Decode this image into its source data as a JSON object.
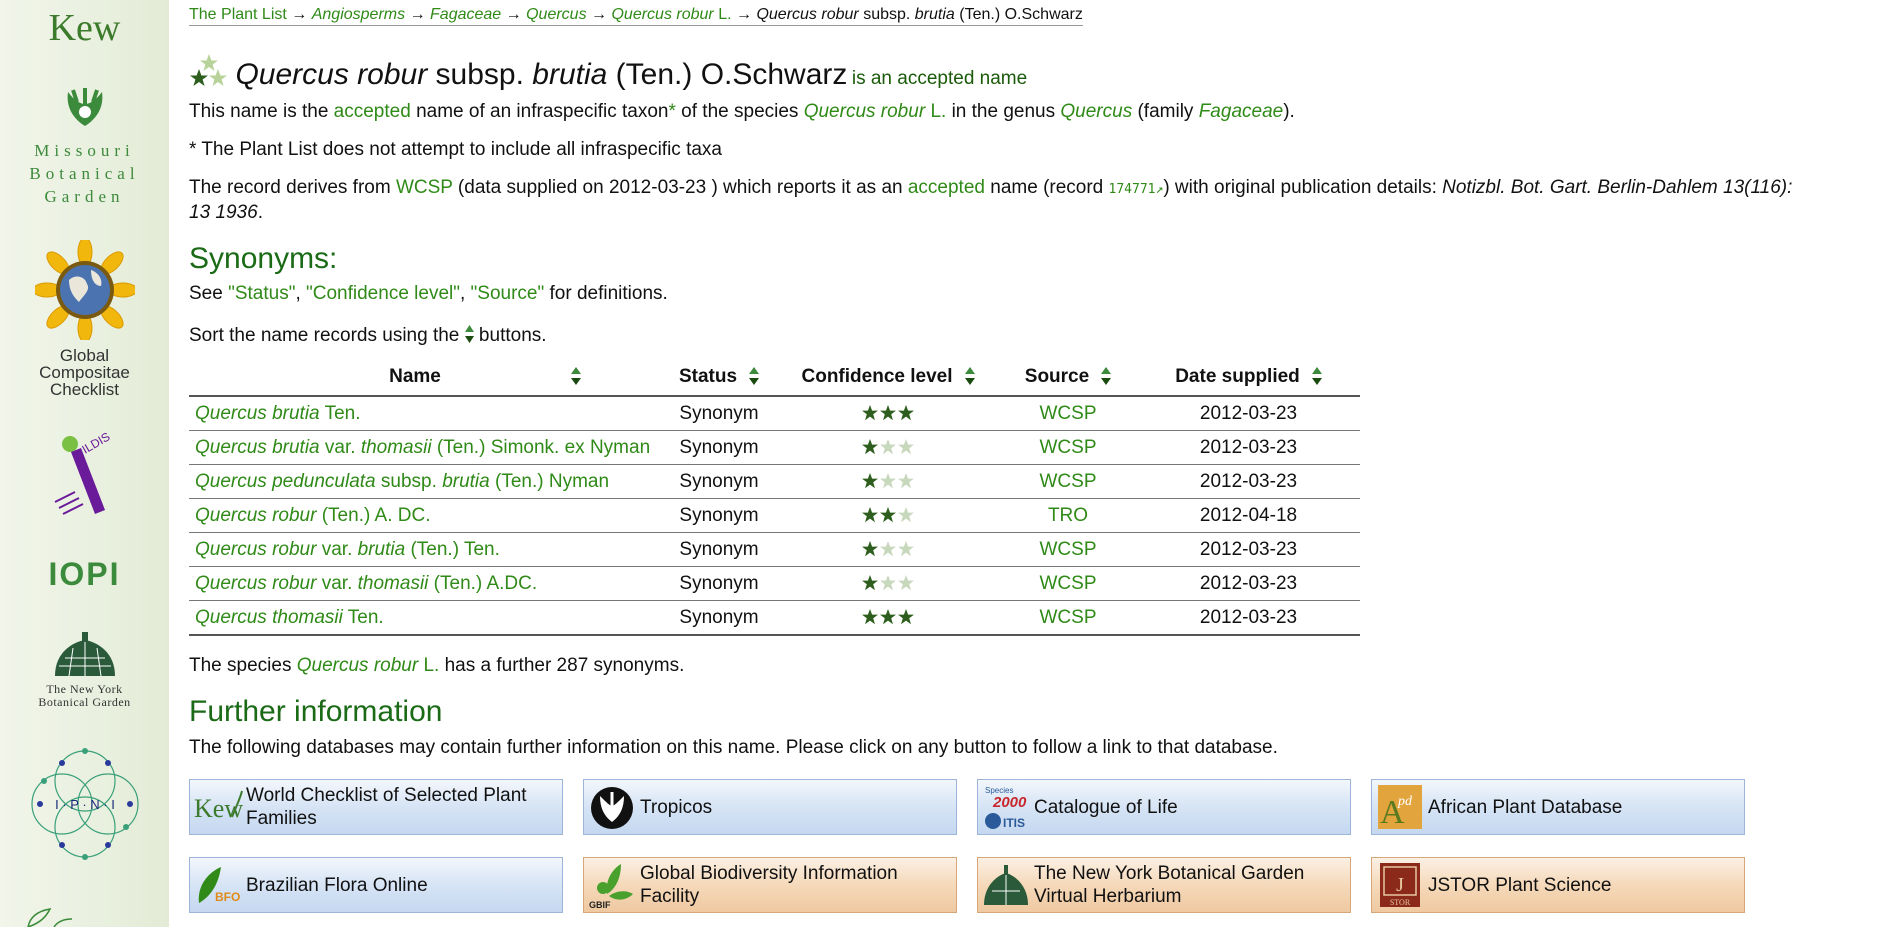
{
  "sidebar": {
    "kew": "Kew",
    "mbg": [
      "Missouri",
      "Botanical",
      "Garden"
    ],
    "gcc": [
      "Global",
      "Compositae",
      "Checklist"
    ],
    "ildis": "ILDIS",
    "iopi": "IOPI",
    "nybg": [
      "The New York",
      "Botanical Garden"
    ],
    "ipni": "I · P · N · I"
  },
  "breadcrumb": {
    "root": "The Plant List",
    "sep": "→",
    "major_group": "Angiosperms",
    "family": "Fagaceae",
    "genus": "Quercus",
    "species_genus": "Quercus",
    "species_epithet": "robur",
    "species_author": "L.",
    "current_genus": "Quercus",
    "current_epithet": "robur",
    "current_rank": "subsp.",
    "current_infra": "brutia",
    "current_author": "(Ten.) O.Schwarz"
  },
  "title": {
    "genus_species": "Quercus robur",
    "rank": "subsp.",
    "infra": "brutia",
    "author": "(Ten.) O.Schwarz",
    "status_text": "is an accepted name"
  },
  "intro": {
    "t1": "This name is the ",
    "accepted": "accepted",
    "t2": " name of an infraspecific taxon",
    "asterisk": "*",
    "t3": " of the species ",
    "species": "Quercus robur",
    "species_author": "L.",
    "t4": " in the genus ",
    "genus": "Quercus",
    "t5": " (family ",
    "family": "Fagaceae",
    "t6": ")."
  },
  "note": "* The Plant List does not attempt to include all infraspecific taxa",
  "record": {
    "t1": "The record derives from ",
    "source": "WCSP",
    "t2": " (data supplied on 2012-03-23 ) which reports it as an ",
    "accepted": "accepted",
    "t3": " name (record ",
    "record_id": "174771",
    "ext": "↗",
    "t4": ") with original publication details: ",
    "publication_line1": "Notizbl. Bot. Gart. Berlin-Dahlem 13(116):",
    "publication_line2": "13 1936",
    "end": "."
  },
  "synonyms": {
    "heading": "Synonyms:",
    "see_prefix": "See ",
    "status_link": "\"Status\"",
    "comma1": ", ",
    "confidence_link": "\"Confidence level\"",
    "comma2": ", ",
    "source_link": "\"Source\"",
    "see_suffix": " for definitions.",
    "sort_prefix": "Sort the name records using the ",
    "sort_suffix": " buttons.",
    "columns": [
      "Name",
      "Status",
      "Confidence level",
      "Source",
      "Date supplied"
    ],
    "rows": [
      {
        "genus": "Quercus",
        "epithet": "brutia",
        "rank": "",
        "infra": "",
        "author": "Ten.",
        "status": "Synonym",
        "confidence": 3,
        "source": "WCSP",
        "date": "2012-03-23"
      },
      {
        "genus": "Quercus",
        "epithet": "brutia",
        "rank": "var.",
        "infra": "thomasii",
        "author": "(Ten.) Simonk. ex Nyman",
        "status": "Synonym",
        "confidence": 1,
        "source": "WCSP",
        "date": "2012-03-23"
      },
      {
        "genus": "Quercus",
        "epithet": "pedunculata",
        "rank": "subsp.",
        "infra": "brutia",
        "author": "(Ten.) Nyman",
        "status": "Synonym",
        "confidence": 1,
        "source": "WCSP",
        "date": "2012-03-23"
      },
      {
        "genus": "Quercus",
        "epithet": "robur",
        "rank": "",
        "infra": "",
        "author": "(Ten.) A. DC.",
        "status": "Synonym",
        "confidence": 2,
        "source": "TRO",
        "date": "2012-04-18"
      },
      {
        "genus": "Quercus",
        "epithet": "robur",
        "rank": "var.",
        "infra": "brutia",
        "author": "(Ten.) Ten.",
        "status": "Synonym",
        "confidence": 1,
        "source": "WCSP",
        "date": "2012-03-23"
      },
      {
        "genus": "Quercus",
        "epithet": "robur",
        "rank": "var.",
        "infra": "thomasii",
        "author": "(Ten.) A.DC.",
        "status": "Synonym",
        "confidence": 1,
        "source": "WCSP",
        "date": "2012-03-23"
      },
      {
        "genus": "Quercus",
        "epithet": "thomasii",
        "rank": "",
        "infra": "",
        "author": "Ten.",
        "status": "Synonym",
        "confidence": 3,
        "source": "WCSP",
        "date": "2012-03-23"
      }
    ],
    "further_prefix": "The species ",
    "further_species": "Quercus robur",
    "further_author": "L.",
    "further_suffix": " has a further 287 synonyms."
  },
  "further": {
    "heading": "Further information",
    "text": "The following databases may contain further information on this name. Please click on any button to follow a link to that database.",
    "buttons": [
      {
        "label": "World Checklist of Selected Plant Families",
        "icon": "kew-logo-icon",
        "style": "blue"
      },
      {
        "label": "Tropicos",
        "icon": "tropicos-logo-icon",
        "style": "blue"
      },
      {
        "label": "Catalogue of Life",
        "icon": "catalogue-of-life-logo-icon",
        "style": "blue"
      },
      {
        "label": "African Plant Database",
        "icon": "african-plant-database-logo-icon",
        "style": "blue"
      },
      {
        "label": "Brazilian Flora Online",
        "icon": "bfo-logo-icon",
        "style": "blue"
      },
      {
        "label": "Global Biodiversity Information Facility",
        "icon": "gbif-logo-icon",
        "style": "orange"
      },
      {
        "label": "The New York Botanical Garden Virtual Herbarium",
        "icon": "nybg-logo-icon",
        "style": "orange"
      },
      {
        "label": "JSTOR Plant Science",
        "icon": "jstor-logo-icon",
        "style": "orange"
      }
    ],
    "icon_text": {
      "kew": "Kew",
      "col_species": "Species",
      "col_2000": "2000",
      "col_itis": "ITIS",
      "apd": "Apd",
      "bfo": "BFO",
      "gbif": "GBIF"
    }
  },
  "colors": {
    "link": "#2f8a17",
    "heading": "#1a6a16",
    "star_on": "#2d5e1e",
    "star_off": "#c8d8bc"
  }
}
